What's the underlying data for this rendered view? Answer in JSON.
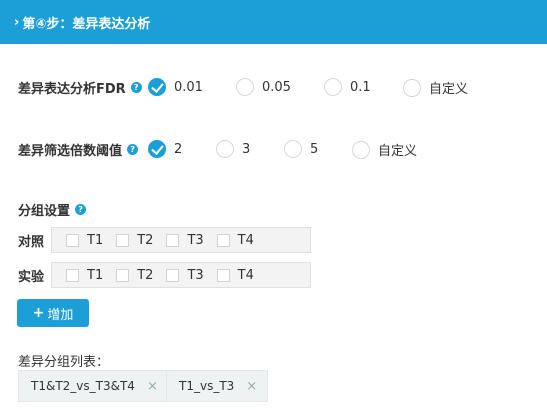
{
  "header": {
    "chevron": "›",
    "title": "第④步：差异表达分析"
  },
  "fdr": {
    "label": "差异表达分析FDR",
    "help": "?",
    "options": [
      {
        "label": "0.01",
        "checked": true
      },
      {
        "label": "0.05",
        "checked": false
      },
      {
        "label": "0.1",
        "checked": false
      },
      {
        "label": "自定义",
        "checked": false
      }
    ]
  },
  "fold": {
    "label": "差异筛选倍数阈值",
    "help": "?",
    "options": [
      {
        "label": "2",
        "checked": true
      },
      {
        "label": "3",
        "checked": false
      },
      {
        "label": "5",
        "checked": false
      },
      {
        "label": "自定义",
        "checked": false
      }
    ]
  },
  "grouping": {
    "label": "分组设置",
    "help": "?",
    "control": {
      "label": "对照",
      "items": [
        "T1",
        "T2",
        "T3",
        "T4"
      ]
    },
    "experiment": {
      "label": "实验",
      "items": [
        "T1",
        "T2",
        "T3",
        "T4"
      ]
    }
  },
  "add_button": {
    "plus": "+",
    "label": "增加"
  },
  "diff_list": {
    "title": "差异分组列表：",
    "tags": [
      {
        "label": "T1&T2_vs_T3&T4",
        "close": "×"
      },
      {
        "label": "T1_vs_T3",
        "close": "×"
      }
    ]
  },
  "colors": {
    "accent": "#1c9fd6"
  }
}
